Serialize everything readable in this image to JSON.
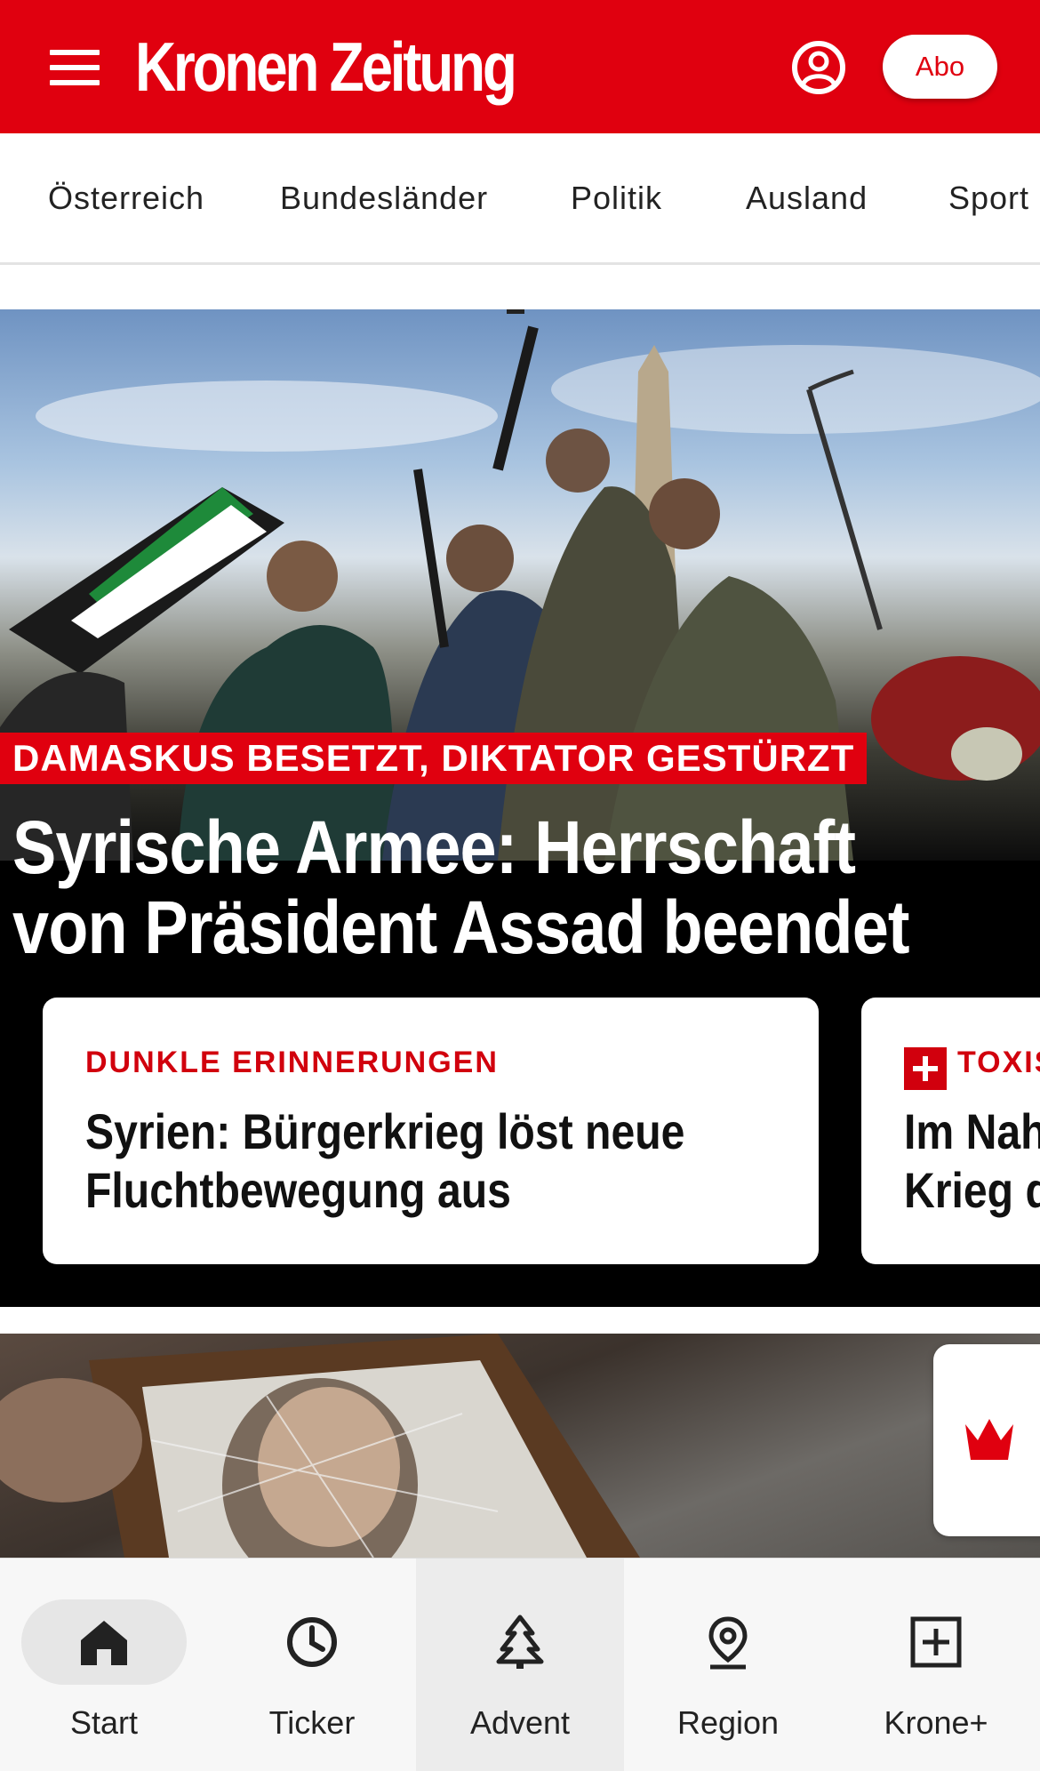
{
  "header": {
    "logo_text": "Kronen Zeitung",
    "subscribe_label": "Abo",
    "brand_color": "#e0000f"
  },
  "categories": [
    "Österreich",
    "Bundesländer",
    "Politik",
    "Ausland",
    "Sport"
  ],
  "hero": {
    "kicker": "DAMASKUS BESETZT, DIKTATOR GESTÜRZT",
    "title_line1": "Syrische Armee: Herrschaft",
    "title_line2": "von Präsident Assad beendet"
  },
  "cards": [
    {
      "kicker": "DUNKLE ERINNERUNGEN",
      "title_line1": "Syrien: Bürgerkrieg löst neue",
      "title_line2": "Fluchtbewegung aus",
      "premium": false
    },
    {
      "kicker": "TOXIS",
      "title_line1": "Im Nah",
      "title_line2": "Krieg d",
      "premium": true
    }
  ],
  "bottom_nav": [
    {
      "label": "Start",
      "icon": "home-icon",
      "active": true
    },
    {
      "label": "Ticker",
      "icon": "clock-icon",
      "active": false
    },
    {
      "label": "Advent",
      "icon": "tree-icon",
      "active": false
    },
    {
      "label": "Region",
      "icon": "location-pin-icon",
      "active": false
    },
    {
      "label": "Krone+",
      "icon": "plus-box-icon",
      "active": false
    }
  ]
}
